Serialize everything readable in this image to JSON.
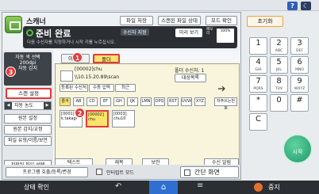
{
  "topbar": {
    "help_label": "?",
    "night_label": "☾"
  },
  "header": {
    "app_title": "스캐너",
    "file_save": "파일 저장",
    "scan_file_status": "스캔된 파일 상태",
    "mode_confirm": "모드 확인",
    "status_title": "준비 완료",
    "status_sub": "다음 수신자를 지정하거나 시작 키를 누르십시오.",
    "dest_label": "수신자 지정",
    "preview": "미리 보기",
    "memory_label": "메모리",
    "memory_value": "100%"
  },
  "left": {
    "auto_select": [
      "자동 색 선택",
      "200dpi",
      "자동 감지"
    ],
    "scan_settings": "스캔 설정",
    "zoom_label": "자동 농도",
    "buttons": [
      "원본 설정",
      "원본 감지/교정",
      "파일 유형/이름/보안"
    ],
    "save_file_select": "저장된 파일 선택"
  },
  "center": {
    "tab_email": "이메일",
    "tab_folder": "폴더",
    "dest_name": "[00002]chu",
    "dest_count": "폴더 수신처: 1",
    "dest_path": "\\\\10.15.20.89\\scan",
    "dest_list_btn": "대상목록",
    "register_dest": "등록된 수신처",
    "manual_input": "수동 입력",
    "recent": "최근",
    "index_tabs": [
      "즐겨",
      "AB",
      "CD",
      "EF",
      "GH",
      "IJK",
      "LMN",
      "OPQ",
      "RST",
      "UVW",
      "XYZ"
    ],
    "index_edit": "자주쓰는번호",
    "entries": [
      {
        "line1": "[0001]",
        "line2": "k.takagi"
      },
      {
        "line1": "[00002]",
        "line2": "chu"
      },
      {
        "line1": "[0003]",
        "line2": "chu10"
      }
    ],
    "footer": [
      "텍스트",
      "제목",
      "보안",
      "수신 알림"
    ]
  },
  "bottom": {
    "program": "프로그램 호출/등록/변경",
    "interrupt": "인터럽트 모드",
    "simple_screen": "간단 화면"
  },
  "badges": {
    "one": "1",
    "two": "2",
    "three": "3"
  },
  "keypad": {
    "reset": "초기화",
    "keys": [
      {
        "digit": "1",
        "letters": ""
      },
      {
        "digit": "2",
        "letters": "ABC"
      },
      {
        "digit": "3",
        "letters": "DEF"
      },
      {
        "digit": "4",
        "letters": "GHI"
      },
      {
        "digit": "5",
        "letters": "JKL"
      },
      {
        "digit": "6",
        "letters": "MNO"
      },
      {
        "digit": "7",
        "letters": "PQRS"
      },
      {
        "digit": "8",
        "letters": "TUV"
      },
      {
        "digit": "9",
        "letters": "WXYZ"
      },
      {
        "digit": "*",
        "letters": ""
      },
      {
        "digit": "0",
        "letters": ""
      },
      {
        "digit": "#",
        "letters": ""
      },
      {
        "digit": "C",
        "letters": ""
      }
    ],
    "start": "시작"
  },
  "sysbar": {
    "status_check": "상태 확인",
    "back": "↶",
    "home": "⌂",
    "menu": "≡",
    "stop": "중지"
  },
  "colors": {
    "accent_red": "#e53a3a",
    "folder_tab": "#fbe36c",
    "home_blue": "#2f6fd1",
    "start_green": "#1e9a68"
  }
}
